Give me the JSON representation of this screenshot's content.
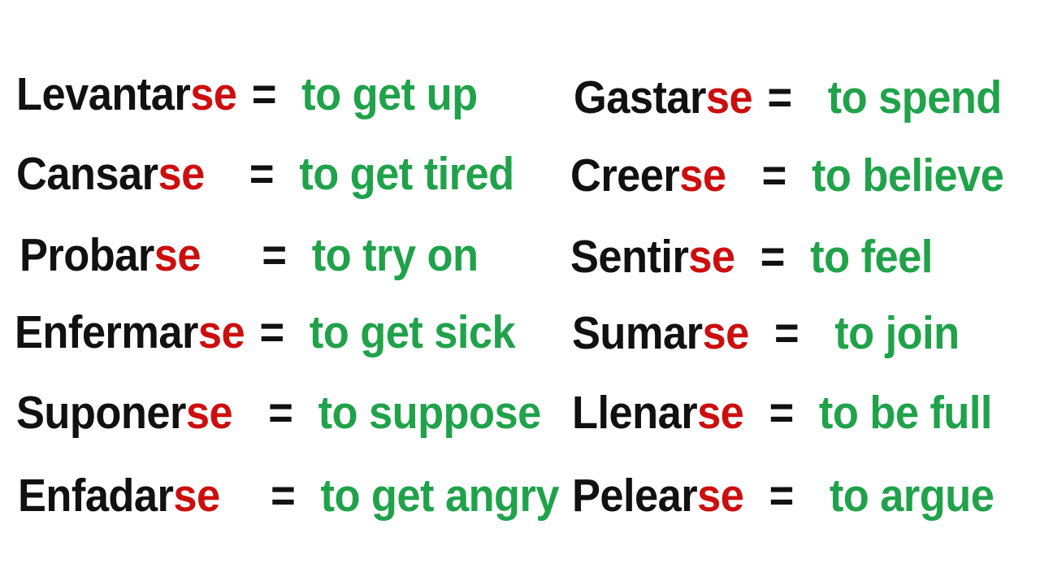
{
  "slide": {
    "background_color": "#ffffff",
    "verb_color": "#111111",
    "suffix_color": "#cc0e0e",
    "equals_color": "#111111",
    "translation_color": "#20a24a",
    "equals_symbol": "="
  },
  "columns": [
    {
      "name": "left-column",
      "rows": [
        {
          "stem": "Levantar",
          "suffix": "se",
          "equals": "=",
          "translation": "to get up"
        },
        {
          "stem": "Cansar",
          "suffix": "se",
          "equals": "=",
          "translation": "to get tired"
        },
        {
          "stem": "Probar",
          "suffix": "se",
          "equals": "=",
          "translation": "to try on"
        },
        {
          "stem": "Enfermar",
          "suffix": "se",
          "equals": "=",
          "translation": "to get sick"
        },
        {
          "stem": "Suponer",
          "suffix": "se",
          "equals": "=",
          "translation": "to suppose"
        },
        {
          "stem": "Enfadar",
          "suffix": "se",
          "equals": "=",
          "translation": "to get angry"
        }
      ]
    },
    {
      "name": "right-column",
      "rows": [
        {
          "stem": "Gastar",
          "suffix": "se",
          "equals": "=",
          "translation": "to spend"
        },
        {
          "stem": "Creer",
          "suffix": "se",
          "equals": "=",
          "translation": "to believe"
        },
        {
          "stem": "Sentir",
          "suffix": "se",
          "equals": "=",
          "translation": "to feel"
        },
        {
          "stem": "Sumar",
          "suffix": "se",
          "equals": "=",
          "translation": "to join"
        },
        {
          "stem": "Llenar",
          "suffix": "se",
          "equals": "=",
          "translation": "to be full"
        },
        {
          "stem": "Pelear",
          "suffix": "se",
          "equals": "=",
          "translation": "to argue"
        }
      ]
    }
  ]
}
